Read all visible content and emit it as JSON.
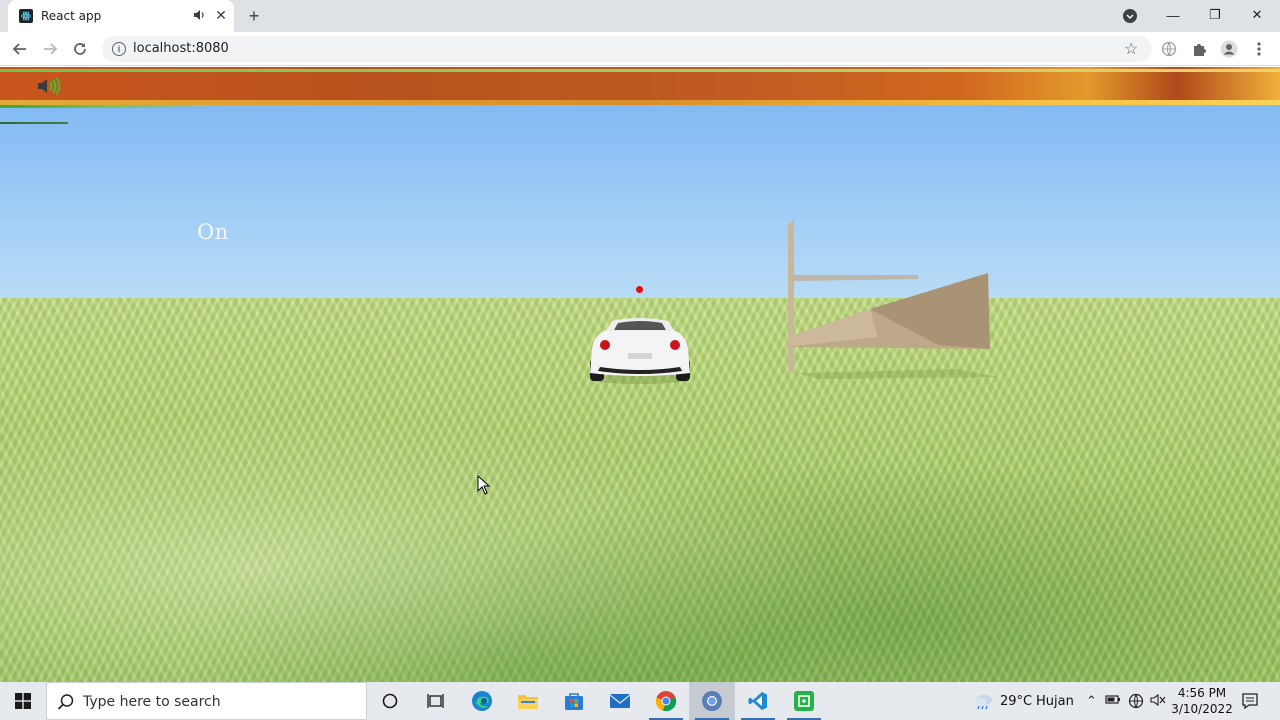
{
  "browser": {
    "tab": {
      "title": "React app"
    },
    "new_tab_label": "+",
    "address": {
      "url": "localhost:8080"
    },
    "window_controls": {
      "minimize": "—",
      "restore": "❐",
      "close": "✕"
    }
  },
  "game": {
    "status_label": "On",
    "sound_icon": "speaker-on-icon",
    "accent_colors": {
      "dot": "#e01010",
      "sky": "#78b3f3",
      "grass": "#a7c866",
      "banner": "#c8551c"
    }
  },
  "taskbar": {
    "search_placeholder": "Type here to search",
    "apps": [
      "cortana",
      "task-view",
      "edge",
      "file-explorer",
      "microsoft-store",
      "mail",
      "chrome",
      "chrome-dev",
      "vscode",
      "app-green"
    ],
    "weather": {
      "temp": "29°C",
      "desc": "Hujan"
    },
    "clock": {
      "time": "4:56 PM",
      "date": "3/10/2022"
    }
  }
}
